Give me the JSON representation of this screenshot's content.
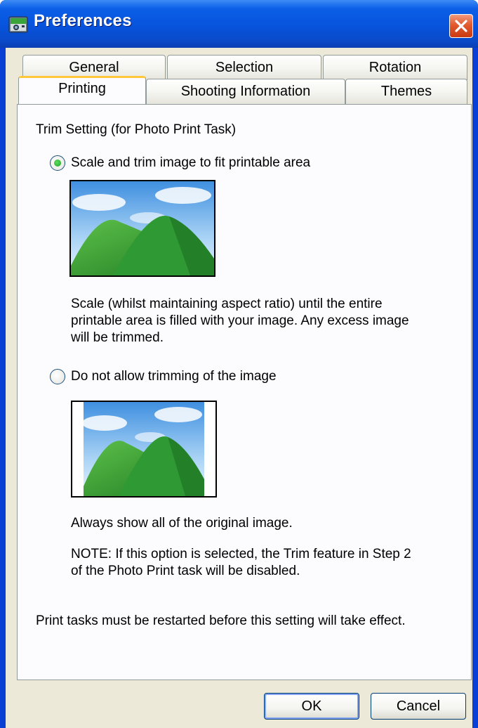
{
  "window": {
    "title": "Preferences"
  },
  "tabs": {
    "row_back": [
      "General",
      "Selection",
      "Rotation"
    ],
    "row_front": [
      "Printing",
      "Shooting Information",
      "Themes"
    ],
    "active": "Printing"
  },
  "panel": {
    "heading": "Trim Setting (for Photo Print Task)",
    "option1": {
      "label": "Scale and trim image to fit printable area",
      "selected": true,
      "desc": [
        "Scale (whilst maintaining aspect ratio) until the entire",
        "printable area is filled with your image. Any excess image",
        "will be trimmed."
      ]
    },
    "option2": {
      "label": "Do not allow trimming of the image",
      "selected": false,
      "desc": "Always show all of the original image.",
      "note": [
        "NOTE: If this option is selected, the Trim feature in Step 2",
        "of the Photo Print task will be disabled."
      ]
    },
    "footer": "Print tasks must be restarted before this setting will take effect."
  },
  "buttons": {
    "ok": "OK",
    "cancel": "Cancel"
  },
  "icons": {
    "app": "preferences-app-icon",
    "close": "close-icon"
  }
}
